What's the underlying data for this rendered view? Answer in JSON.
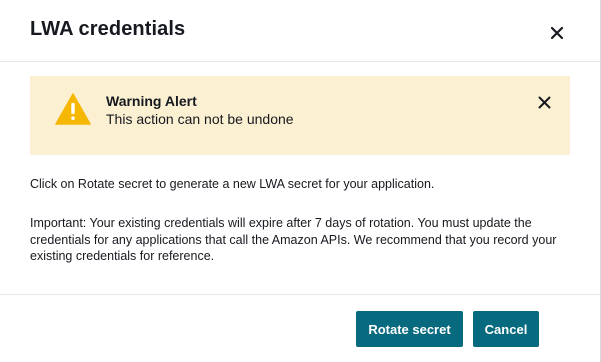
{
  "modal": {
    "title": "LWA credentials",
    "close_icon": "close-icon"
  },
  "alert": {
    "type": "warning",
    "icon": "warning-triangle-icon",
    "title": "Warning Alert",
    "message": "This action can not be undone",
    "dismiss_icon": "close-icon",
    "background_color": "#fbf0d2",
    "icon_color": "#f5b700"
  },
  "body": {
    "paragraph_1": "Click on Rotate secret to generate a new LWA secret for your application.",
    "paragraph_2": "Important: Your existing credentials will expire after 7 days of rotation. You must update the credentials for any applications that call the Amazon APIs. We recommend that you record your existing credentials for reference."
  },
  "footer": {
    "rotate_label": "Rotate secret",
    "cancel_label": "Cancel",
    "button_color": "#076a7e"
  }
}
